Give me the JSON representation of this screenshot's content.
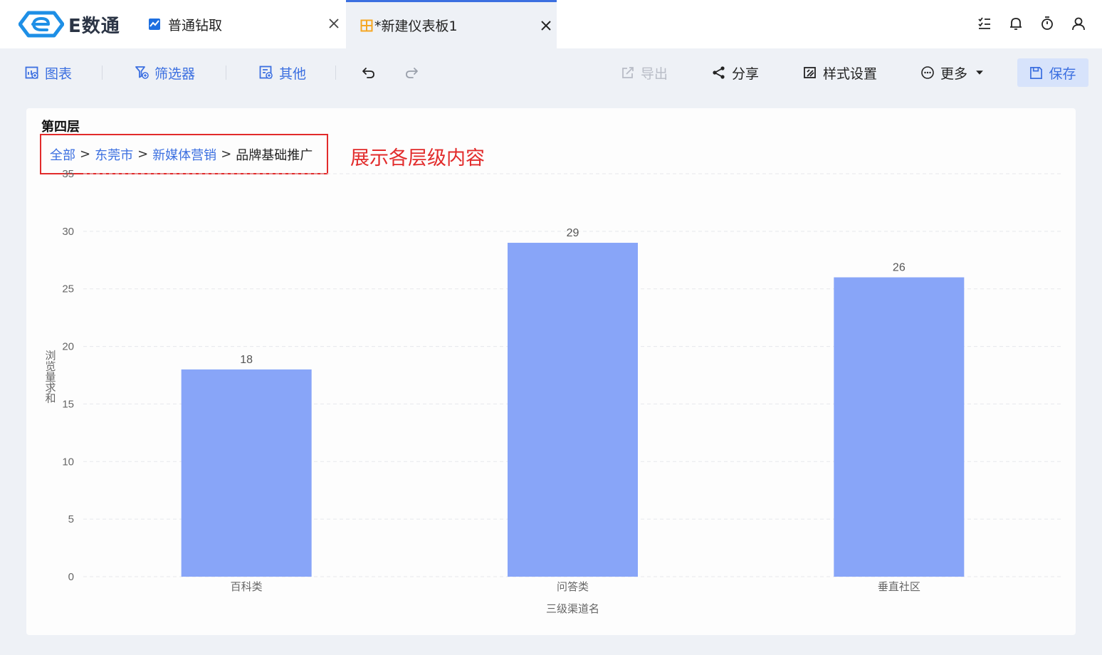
{
  "app": {
    "brand": "E数通"
  },
  "tabs": [
    {
      "label": "普通钻取",
      "icon": "line-chart-icon",
      "active": false
    },
    {
      "label": "*新建仪表板1",
      "icon": "dashboard-icon",
      "active": true
    }
  ],
  "top_icons": [
    "task-list-icon",
    "bell-icon",
    "timer-icon",
    "user-icon"
  ],
  "toolbar": {
    "chart": "图表",
    "filter": "筛选器",
    "other": "其他",
    "export": "导出",
    "share": "分享",
    "style": "样式设置",
    "more": "更多",
    "save": "保存"
  },
  "colors": {
    "accent": "#3b6fe0",
    "bar": "#88a5f8",
    "annotation": "#e22b2b"
  },
  "card": {
    "title": "第四层",
    "breadcrumb": [
      {
        "label": "全部",
        "link": true
      },
      {
        "label": "东莞市",
        "link": true
      },
      {
        "label": "新媒体营销",
        "link": true
      },
      {
        "label": "品牌基础推广",
        "link": false
      }
    ],
    "breadcrumb_sep": ">",
    "annotation": "展示各层级内容"
  },
  "chart_data": {
    "type": "bar",
    "categories": [
      "百科类",
      "问答类",
      "垂直社区"
    ],
    "values": [
      18,
      29,
      26
    ],
    "xlabel": "三级渠道名",
    "ylabel": "浏览量求和",
    "ylim": [
      0,
      35
    ],
    "yticks": [
      0,
      5,
      10,
      15,
      20,
      25,
      30,
      35
    ],
    "grid": true,
    "data_labels": true
  }
}
